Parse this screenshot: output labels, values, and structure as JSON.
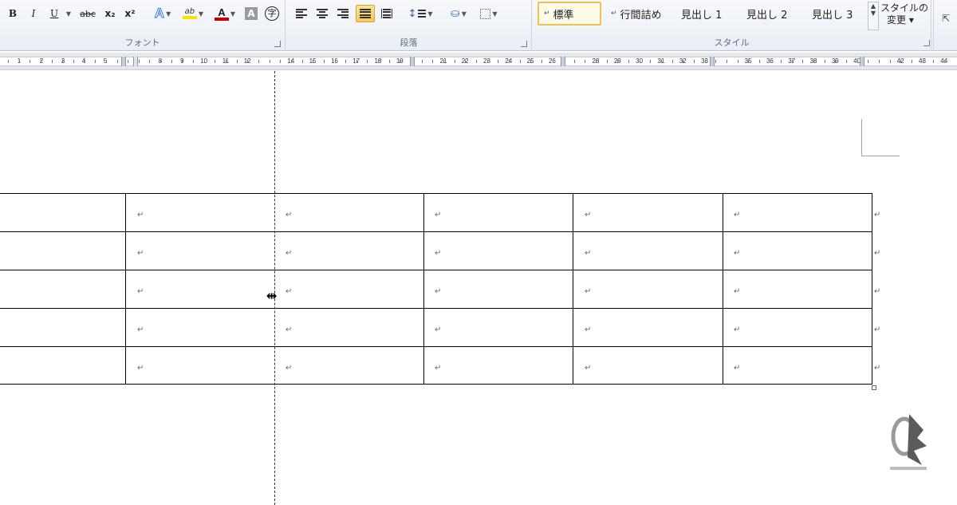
{
  "ribbon": {
    "font_group": {
      "label": "フォント",
      "buttons": {
        "bold": "B",
        "italic": "I",
        "underline": "U",
        "strikethrough": "abc",
        "subscript": "x₂",
        "superscript": "x²",
        "text_effects": "A",
        "highlight": "ab",
        "font_color": "A",
        "char_shading": "A",
        "enclosed_char": "字"
      }
    },
    "paragraph_group": {
      "label": "段落"
    },
    "styles_group": {
      "label": "スタイル",
      "items": [
        "標準",
        "行間詰め",
        "見出し 1",
        "見出し 2",
        "見出し 3"
      ],
      "selected": "標準",
      "change_styles_line1": "スタイルの",
      "change_styles_line2": "変更 ▾"
    },
    "colors": {
      "highlight_color": "#f5e400",
      "font_color": "#c00000",
      "active_bg": "#f8c75a"
    }
  },
  "ruler": {
    "left_numbers": [
      "1",
      "2",
      "3",
      "4",
      "5"
    ],
    "numbers": [
      "8",
      "9",
      "10",
      "11",
      "12",
      "14",
      "15",
      "16",
      "17",
      "18",
      "19",
      "21",
      "22",
      "23",
      "24",
      "25",
      "26",
      "28",
      "29",
      "30",
      "31",
      "32",
      "33",
      "35",
      "36",
      "37",
      "38",
      "39",
      "40",
      "42",
      "43",
      "44"
    ]
  },
  "document": {
    "table": {
      "rows": 5,
      "cell_mark": "↵",
      "row_end_mark": "↵"
    }
  },
  "icons": [
    "text-effects-icon",
    "highlighter-icon",
    "font-color-icon",
    "align-left-icon",
    "align-center-icon",
    "align-right-icon",
    "justify-icon",
    "distributed-icon",
    "line-spacing-icon",
    "shading-icon",
    "borders-icon",
    "column-resize-cursor-icon"
  ]
}
